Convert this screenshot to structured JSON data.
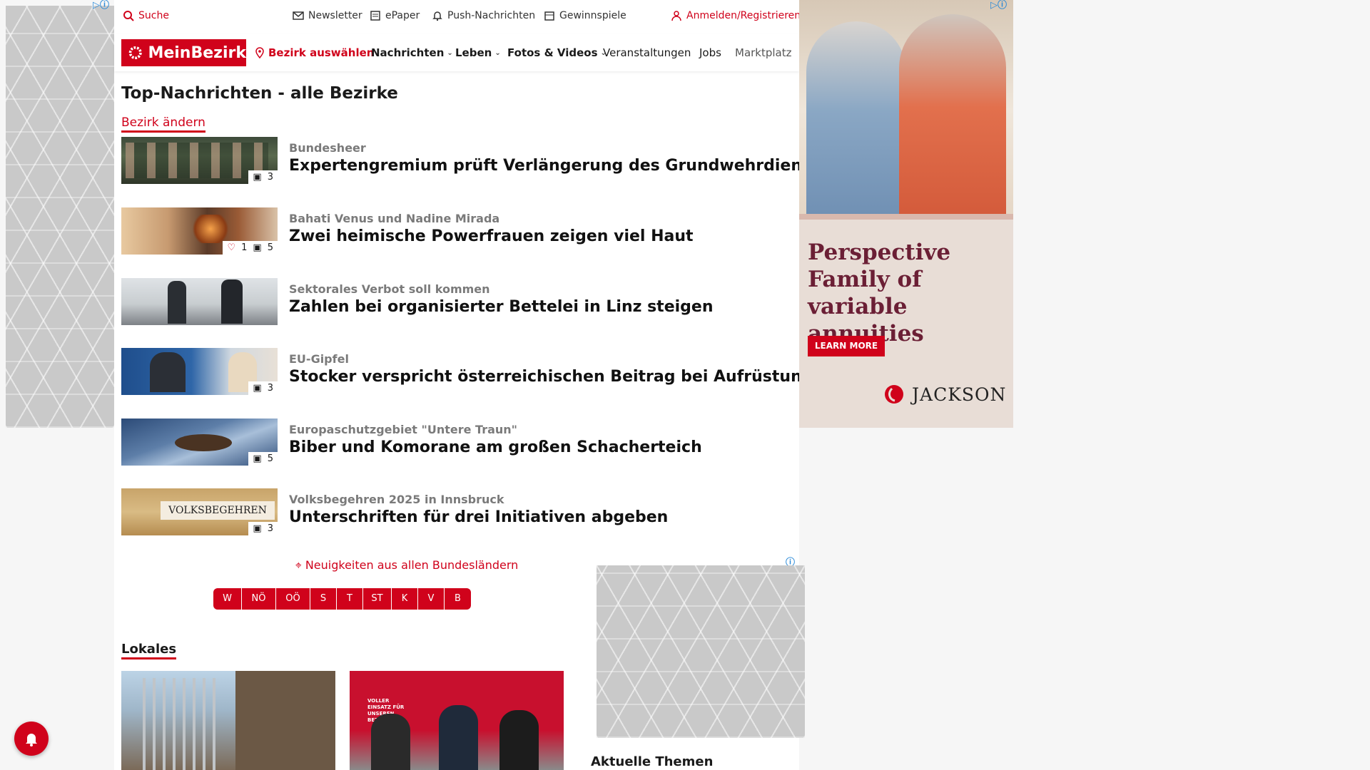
{
  "utility_bar": {
    "search": "Suche",
    "newsletter": "Newsletter",
    "epaper": "ePaper",
    "push": "Push-Nachrichten",
    "games": "Gewinnspiele",
    "login": "Anmelden/Registrieren"
  },
  "nav": {
    "logo": "MeinBezirk",
    "district_select": "Bezirk auswählen",
    "items": [
      "Nachrichten",
      "Leben",
      "Fotos & Videos",
      "Veranstaltungen",
      "Jobs",
      "Marktplatz"
    ]
  },
  "main": {
    "title": "Top-Nachrichten - alle Bezirke",
    "change_district": "Bezirk ändern",
    "articles": [
      {
        "kicker": "Bundesheer",
        "title": "Expertengremium prüft Verlängerung des Grundwehrdienstes",
        "images": "3",
        "likes": ""
      },
      {
        "kicker": "Bahati Venus und Nadine Mirada",
        "title": "Zwei heimische Powerfrauen zeigen viel Haut",
        "images": "5",
        "likes": "1"
      },
      {
        "kicker": "Sektorales Verbot soll kommen",
        "title": "Zahlen bei organisierter Bettelei in Linz steigen",
        "images": "",
        "likes": ""
      },
      {
        "kicker": "EU-Gipfel",
        "title": "Stocker verspricht österreichischen Beitrag bei Aufrüstung",
        "images": "3",
        "likes": ""
      },
      {
        "kicker": "Europaschutzgebiet \"Untere Traun\"",
        "title": "Biber und Komorane am großen Schacherteich",
        "images": "5",
        "likes": ""
      },
      {
        "kicker": "Volksbegehren 2025 in Innsbruck",
        "title": "Unterschriften für drei Initiativen abgeben",
        "images": "3",
        "likes": ""
      }
    ],
    "thumb6_text": "VOLKSBEGEHREN",
    "states_link": "Neuigkeiten aus allen Bundesländern",
    "states": [
      "W",
      "NÖ",
      "OÖ",
      "S",
      "T",
      "ST",
      "K",
      "V",
      "B"
    ],
    "local_heading": "Lokales",
    "local_img2_text": "VOLLER EINSATZ FÜR UNSEREN BEZIRK",
    "topics_heading": "Aktuelle Themen"
  },
  "ads": {
    "right": {
      "headline": "Perspective Family of variable annuities",
      "cta": "LEARN MORE",
      "brand": "JACKSON"
    }
  },
  "colors": {
    "brand": "#d0021b",
    "ad_text": "#6b1f35"
  }
}
